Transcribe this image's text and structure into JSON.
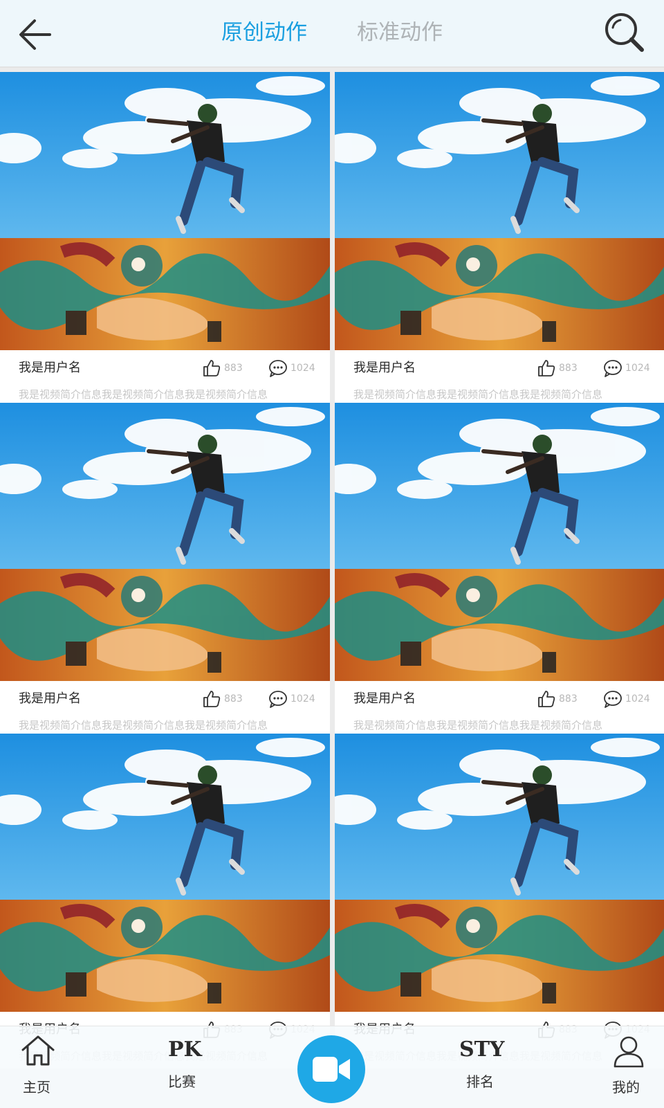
{
  "header": {
    "back_icon": "arrow-left-icon",
    "tabs": [
      {
        "label": "原创动作",
        "active": true
      },
      {
        "label": "标准动作",
        "active": false
      }
    ],
    "search_icon": "search-icon",
    "accent_color": "#1a9fe0",
    "inactive_color": "#aeb3b6"
  },
  "videos": [
    {
      "username": "我是用户名",
      "likes": "883",
      "comments": "1024",
      "description": "我是视频简介信息我是视频简介信息我是视频简介信息"
    },
    {
      "username": "我是用户名",
      "likes": "883",
      "comments": "1024",
      "description": "我是视频简介信息我是视频简介信息我是视频简介信息"
    },
    {
      "username": "我是用户名",
      "likes": "883",
      "comments": "1024",
      "description": "我是视频简介信息我是视频简介信息我是视频简介信息"
    },
    {
      "username": "我是用户名",
      "likes": "883",
      "comments": "1024",
      "description": "我是视频简介信息我是视频简介信息我是视频简介信息"
    },
    {
      "username": "我是用户名",
      "likes": "883",
      "comments": "1024",
      "description": "我是视频简介信息我是视频简介信息我是视频简介信息"
    },
    {
      "username": "我是用户名",
      "likes": "883",
      "comments": "1024",
      "description": "我是视频简介信息我是视频简介信息我是视频简介信息"
    }
  ],
  "bottom_nav": {
    "home": {
      "label": "主页",
      "icon": "home-icon"
    },
    "pk": {
      "label": "比赛",
      "icon_text": "PK"
    },
    "record": {
      "icon": "video-camera-icon",
      "color": "#1fa8e6"
    },
    "rank": {
      "label": "排名",
      "icon_text": "STY"
    },
    "me": {
      "label": "我的",
      "icon": "user-icon"
    }
  }
}
